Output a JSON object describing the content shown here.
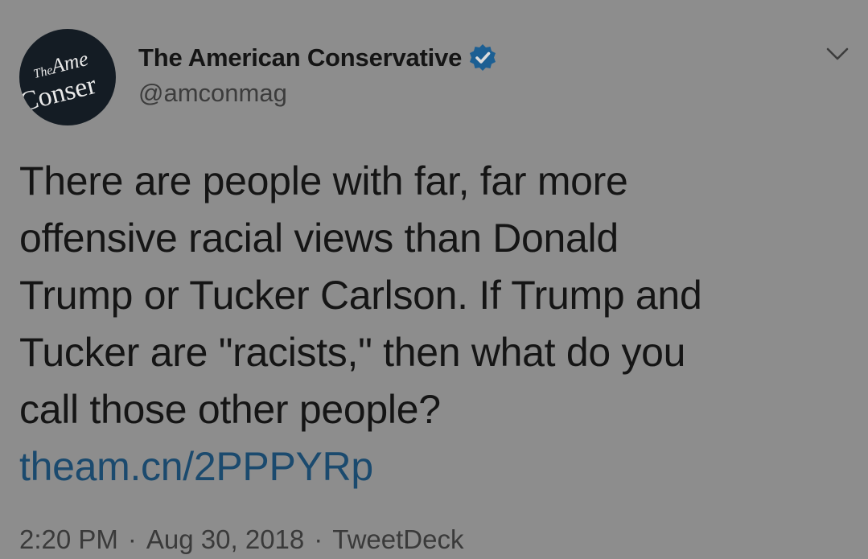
{
  "colors": {
    "background": "#8d8d8d",
    "text": "#151515",
    "secondary_text": "#3c3c3c",
    "link": "#1b4a6e",
    "verified_badge": "#1c5f93",
    "avatar_bg": "#141c24"
  },
  "account": {
    "avatar_logo_line1_small": "The",
    "avatar_logo_line1": "Ame",
    "avatar_logo_line2": "Conser",
    "display_name": "The American Conservative",
    "handle": "@amconmag",
    "verified_icon": "verified-badge-icon"
  },
  "menu": {
    "icon": "chevron-down-icon"
  },
  "tweet": {
    "lines": [
      "There are people with far, far more",
      "offensive racial views than Donald",
      "Trump or Tucker Carlson. If Trump and",
      "Tucker are \"racists,\" then what do you",
      "call those other people?"
    ],
    "link": "theam.cn/2PPPYRp"
  },
  "meta": {
    "time": "2:20 PM",
    "date": "Aug 30, 2018",
    "source": "TweetDeck",
    "separator": "·"
  }
}
